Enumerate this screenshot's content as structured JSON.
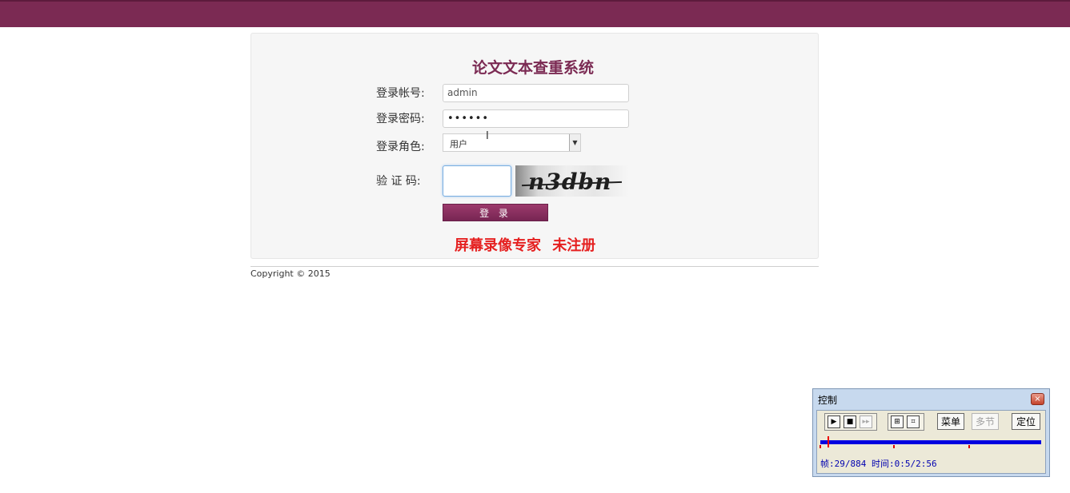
{
  "login": {
    "title": "论文文本查重系统",
    "account_label": "登录帐号:",
    "account_value": "admin",
    "password_label": "登录密码:",
    "password_value": "••••••",
    "role_label": "登录角色:",
    "role_selected": "用户",
    "captcha_label": "验 证 码:",
    "captcha_text": "n3dbn",
    "login_button": "登 录"
  },
  "watermark": "屏幕录像专家 未注册",
  "footer": {
    "copyright": "Copyright © 2015"
  },
  "control_panel": {
    "title": "控制",
    "close": "×",
    "menu_button": "菜单",
    "multi_button": "多节",
    "locate_button": "定位",
    "status": "帧:29/884 时间:0:5/2:56"
  },
  "colors": {
    "brand": "#7b2a53",
    "watermark": "#e52020",
    "timeline": "#0000e0"
  }
}
